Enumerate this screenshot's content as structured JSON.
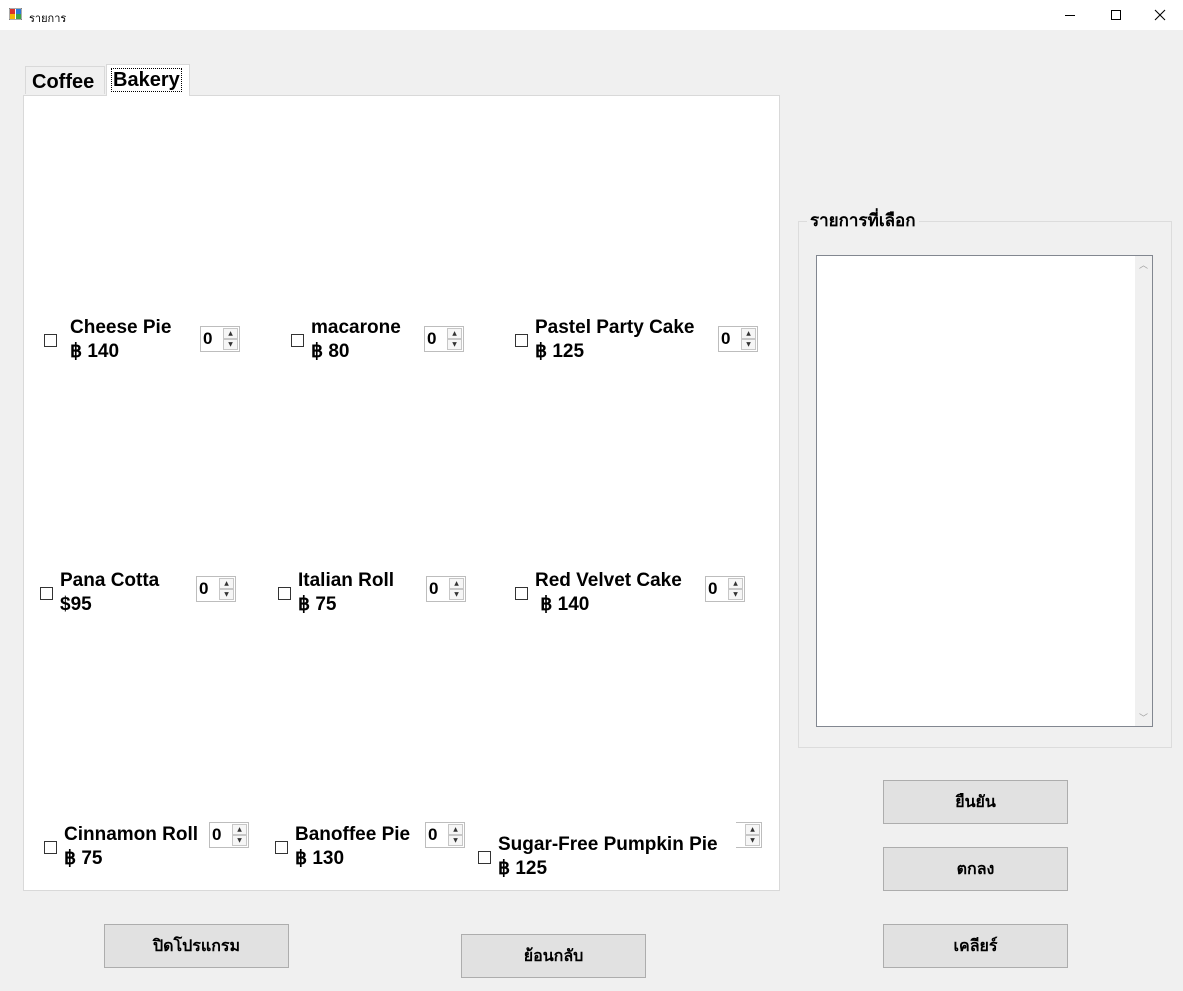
{
  "window": {
    "title": "รายการ"
  },
  "tabs": [
    {
      "label": "Coffee",
      "selected": false
    },
    {
      "label": "Bakery",
      "selected": true
    }
  ],
  "menu": [
    {
      "name": "Cheese Pie",
      "price": "฿ 140",
      "qty": "0",
      "checked": false
    },
    {
      "name": "macarone",
      "price": "฿ 80",
      "qty": "0",
      "checked": false
    },
    {
      "name": "Pastel Party Cake",
      "price": "฿ 125",
      "qty": "0",
      "checked": false
    },
    {
      "name": "Pana Cotta",
      "price": "$95",
      "qty": "0",
      "checked": false
    },
    {
      "name": "Italian Roll",
      "price": "฿ 75",
      "qty": "0",
      "checked": false
    },
    {
      "name": "Red Velvet Cake",
      "price": " ฿ 140",
      "qty": "0",
      "checked": false
    },
    {
      "name": "Cinnamon Roll",
      "price": "฿ 75",
      "qty": "0",
      "checked": false
    },
    {
      "name": "Banoffee Pie",
      "price": "฿ 130",
      "qty": "0",
      "checked": false
    },
    {
      "name": "Sugar-Free Pumpkin Pie",
      "price": "฿ 125",
      "qty": "",
      "checked": false
    }
  ],
  "selected_panel": {
    "title": "รายการที่เลือก",
    "items": []
  },
  "buttons": {
    "confirm": "ยืนยัน",
    "ok": "ตกลง",
    "clear": "เคลียร์",
    "close_program": "ปิดโปรแกรม",
    "back": "ย้อนกลับ"
  }
}
